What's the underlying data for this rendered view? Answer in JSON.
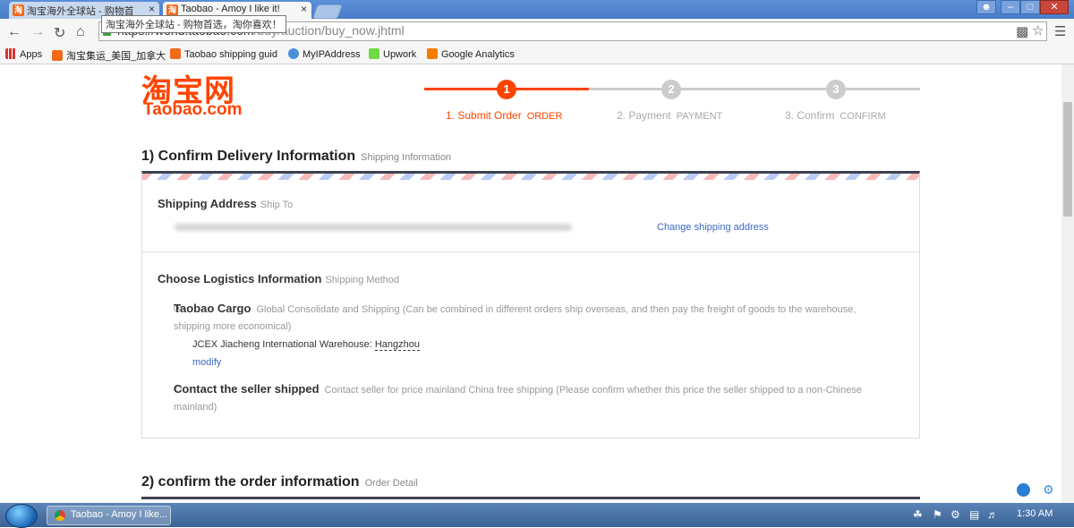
{
  "browser": {
    "tabs": [
      {
        "label": "淘宝海外全球站 - 购物首"
      },
      {
        "label": "Taobao - Amoy I like it!"
      }
    ],
    "tooltip": "淘宝海外全球站 - 购物首选，淘你喜欢！",
    "url_host": "https://world.taobao.com",
    "url_path": "/buy/auction/buy_now.jhtml",
    "bookmarks": [
      {
        "label": "Apps"
      },
      {
        "label": "淘宝集运_美国_加拿大"
      },
      {
        "label": "Taobao shipping guid"
      },
      {
        "label": "MyIPAddress"
      },
      {
        "label": "Upwork"
      },
      {
        "label": "Google Analytics"
      }
    ]
  },
  "logo": {
    "cn": "淘宝网",
    "en": "Taobao.com"
  },
  "steps": [
    {
      "num": "1",
      "label": "1. Submit Order",
      "en": "ORDER",
      "active": true
    },
    {
      "num": "2",
      "label": "2. Payment",
      "en": "PAYMENT",
      "active": false
    },
    {
      "num": "3",
      "label": "3. Confirm",
      "en": "CONFIRM",
      "active": false
    }
  ],
  "section1": {
    "title": "1) Confirm Delivery Information",
    "sub": "Shipping Information"
  },
  "shipping": {
    "title": "Shipping Address",
    "sub": "Ship To",
    "change_link": "Change shipping address"
  },
  "logistics": {
    "title": "Choose Logistics Information",
    "sub": "Shipping Method",
    "option1": {
      "name": "Taobao Cargo",
      "desc": "Global Consolidate and Shipping    (Can be combined in different orders ship overseas, and then pay the freight of goods to the warehouse, shipping more economical)",
      "warehouse_label": "JCEX Jiacheng International Warehouse:",
      "warehouse_city": "Hangzhou",
      "modify": "modify"
    },
    "option2": {
      "name": "Contact the seller shipped",
      "desc": "Contact seller for price    mainland China free shipping (Please confirm whether this price the seller shipped to a non-Chinese mainland)"
    }
  },
  "section2": {
    "title": "2) confirm the order information",
    "sub": "Order Detail"
  },
  "taskbar": {
    "task_label": "Taobao - Amoy I like...",
    "clock": "1:30 AM"
  },
  "colors": {
    "brand": "#ff4400",
    "link": "#3b6ac8",
    "inactive_step": "#cccccc"
  }
}
